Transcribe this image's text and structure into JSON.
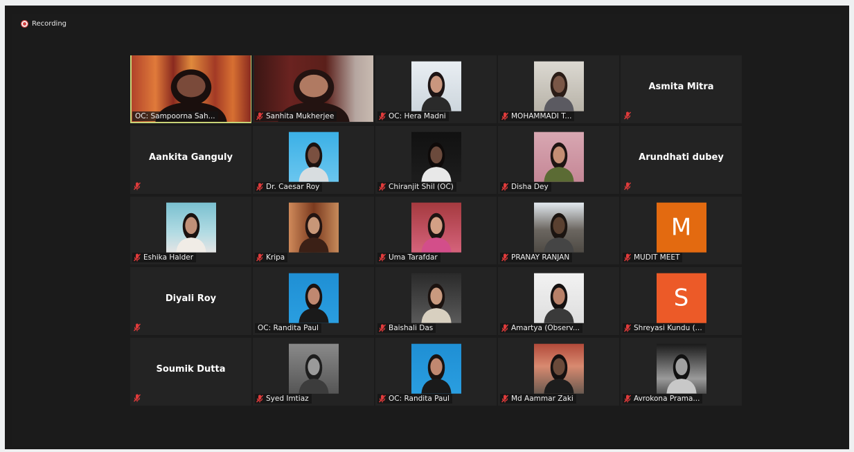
{
  "recording": {
    "label": "Recording"
  },
  "colors": {
    "muted": "#e03b3b",
    "active_border": "#c8d77a",
    "tile_bg": "#232323"
  },
  "participants": [
    {
      "name": "OC: Sampoorna Sah...",
      "video": "sampoorna",
      "muted": false,
      "active": true
    },
    {
      "name": "Sanhita Mukherjee",
      "video": "sanhita",
      "muted": true
    },
    {
      "name": "OC: Hera Madni",
      "video": "hera",
      "muted": true
    },
    {
      "name": "MOHAMMADI T...",
      "video": "mohammadi",
      "muted": true
    },
    {
      "name": "Asmita Mitra",
      "video": null,
      "muted": true
    },
    {
      "name": "Aankita Ganguly",
      "video": null,
      "muted": true
    },
    {
      "name": "Dr. Caesar Roy",
      "video": "caesar",
      "muted": true
    },
    {
      "name": "Chiranjit Shil (OC)",
      "video": "chiranjit",
      "muted": true
    },
    {
      "name": "Disha Dey",
      "video": "disha",
      "muted": true
    },
    {
      "name": "Arundhati dubey",
      "video": null,
      "muted": true
    },
    {
      "name": "Eshika Halder",
      "video": "eshika",
      "muted": true
    },
    {
      "name": "Kripa",
      "video": "kripa",
      "muted": true
    },
    {
      "name": "Uma Tarafdar",
      "video": "uma",
      "muted": true
    },
    {
      "name": "PRANAY RANJAN",
      "video": "pranay",
      "muted": true
    },
    {
      "name": "MUDIT MEET",
      "video": "avatar",
      "avatar_letter": "M",
      "avatar_color": "#e36a10",
      "muted": true
    },
    {
      "name": "Diyali Roy",
      "video": null,
      "muted": true
    },
    {
      "name": "OC: Randita Paul",
      "video": "randita",
      "muted": false
    },
    {
      "name": "Baishali Das",
      "video": "baishali",
      "muted": true
    },
    {
      "name": "Amartya (Observ...",
      "video": "amartya",
      "muted": true
    },
    {
      "name": "Shreyasi Kundu (...",
      "video": "avatar",
      "avatar_letter": "S",
      "avatar_color": "#ec5a28",
      "muted": true
    },
    {
      "name": "Soumik Dutta",
      "video": null,
      "muted": true
    },
    {
      "name": "Syed Imtiaz",
      "video": "syed",
      "muted": true
    },
    {
      "name": "OC: Randita Paul",
      "video": "randita2",
      "muted": true
    },
    {
      "name": "Md Aammar Zaki",
      "video": "aammar",
      "muted": true
    },
    {
      "name": "Avrokona Prama...",
      "video": "avrokona",
      "muted": true
    }
  ]
}
